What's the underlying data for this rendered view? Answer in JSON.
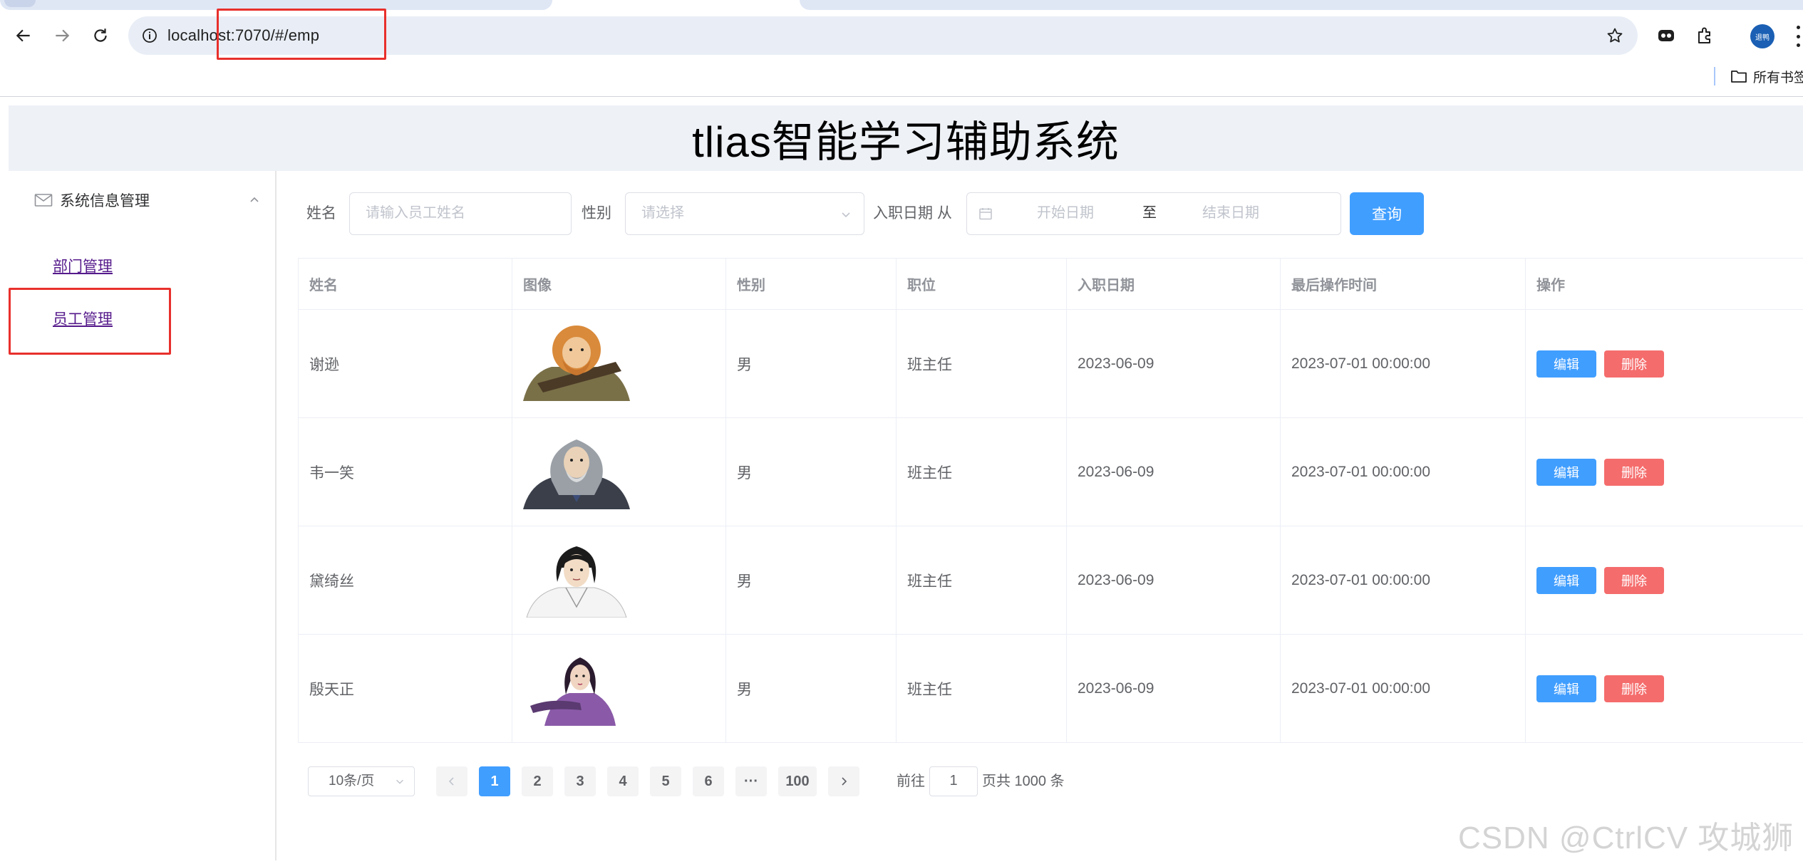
{
  "browser": {
    "url": "localhost:7070/#/emp",
    "profile_label": "退鸭",
    "bookmarks_label": "所有书签"
  },
  "app": {
    "title": "tlias智能学习辅助系统"
  },
  "sidebar": {
    "group_title": "系统信息管理",
    "items": [
      {
        "label": "部门管理"
      },
      {
        "label": "员工管理"
      }
    ]
  },
  "search": {
    "name_label": "姓名",
    "name_placeholder": "请输入员工姓名",
    "gender_label": "性别",
    "gender_placeholder": "请选择",
    "date_label": "入职日期 从",
    "date_start_placeholder": "开始日期",
    "date_separator": "至",
    "date_end_placeholder": "结束日期",
    "query_button": "查询"
  },
  "table": {
    "columns": [
      "姓名",
      "图像",
      "性别",
      "职位",
      "入职日期",
      "最后操作时间",
      "操作"
    ],
    "rows": [
      {
        "name": "谢逊",
        "avatar": "orange-haired-warrior-avatar",
        "gender": "男",
        "job": "班主任",
        "entry_date": "2023-06-09",
        "update_time": "2023-07-01 00:00:00"
      },
      {
        "name": "韦一笑",
        "avatar": "grey-haired-elder-avatar",
        "gender": "男",
        "job": "班主任",
        "entry_date": "2023-06-09",
        "update_time": "2023-07-01 00:00:00"
      },
      {
        "name": "黛绮丝",
        "avatar": "black-haired-scholar-avatar",
        "gender": "男",
        "job": "班主任",
        "entry_date": "2023-06-09",
        "update_time": "2023-07-01 00:00:00"
      },
      {
        "name": "殷天正",
        "avatar": "purple-robed-woman-avatar",
        "gender": "男",
        "job": "班主任",
        "entry_date": "2023-06-09",
        "update_time": "2023-07-01 00:00:00"
      }
    ],
    "edit_label": "编辑",
    "delete_label": "删除"
  },
  "pagination": {
    "page_size": "10条/页",
    "pages": [
      "1",
      "2",
      "3",
      "4",
      "5",
      "6"
    ],
    "ellipsis": "···",
    "last_page": "100",
    "current_page": "1",
    "goto_label": "前往",
    "goto_value": "1",
    "total_text": "页共 1000 条"
  },
  "watermark": "CSDN @CtrlCV 攻城狮",
  "colors": {
    "primary": "#409eff",
    "danger": "#f56c6c",
    "annotation_red": "#e8302c",
    "header_bg": "#eef1f6"
  }
}
